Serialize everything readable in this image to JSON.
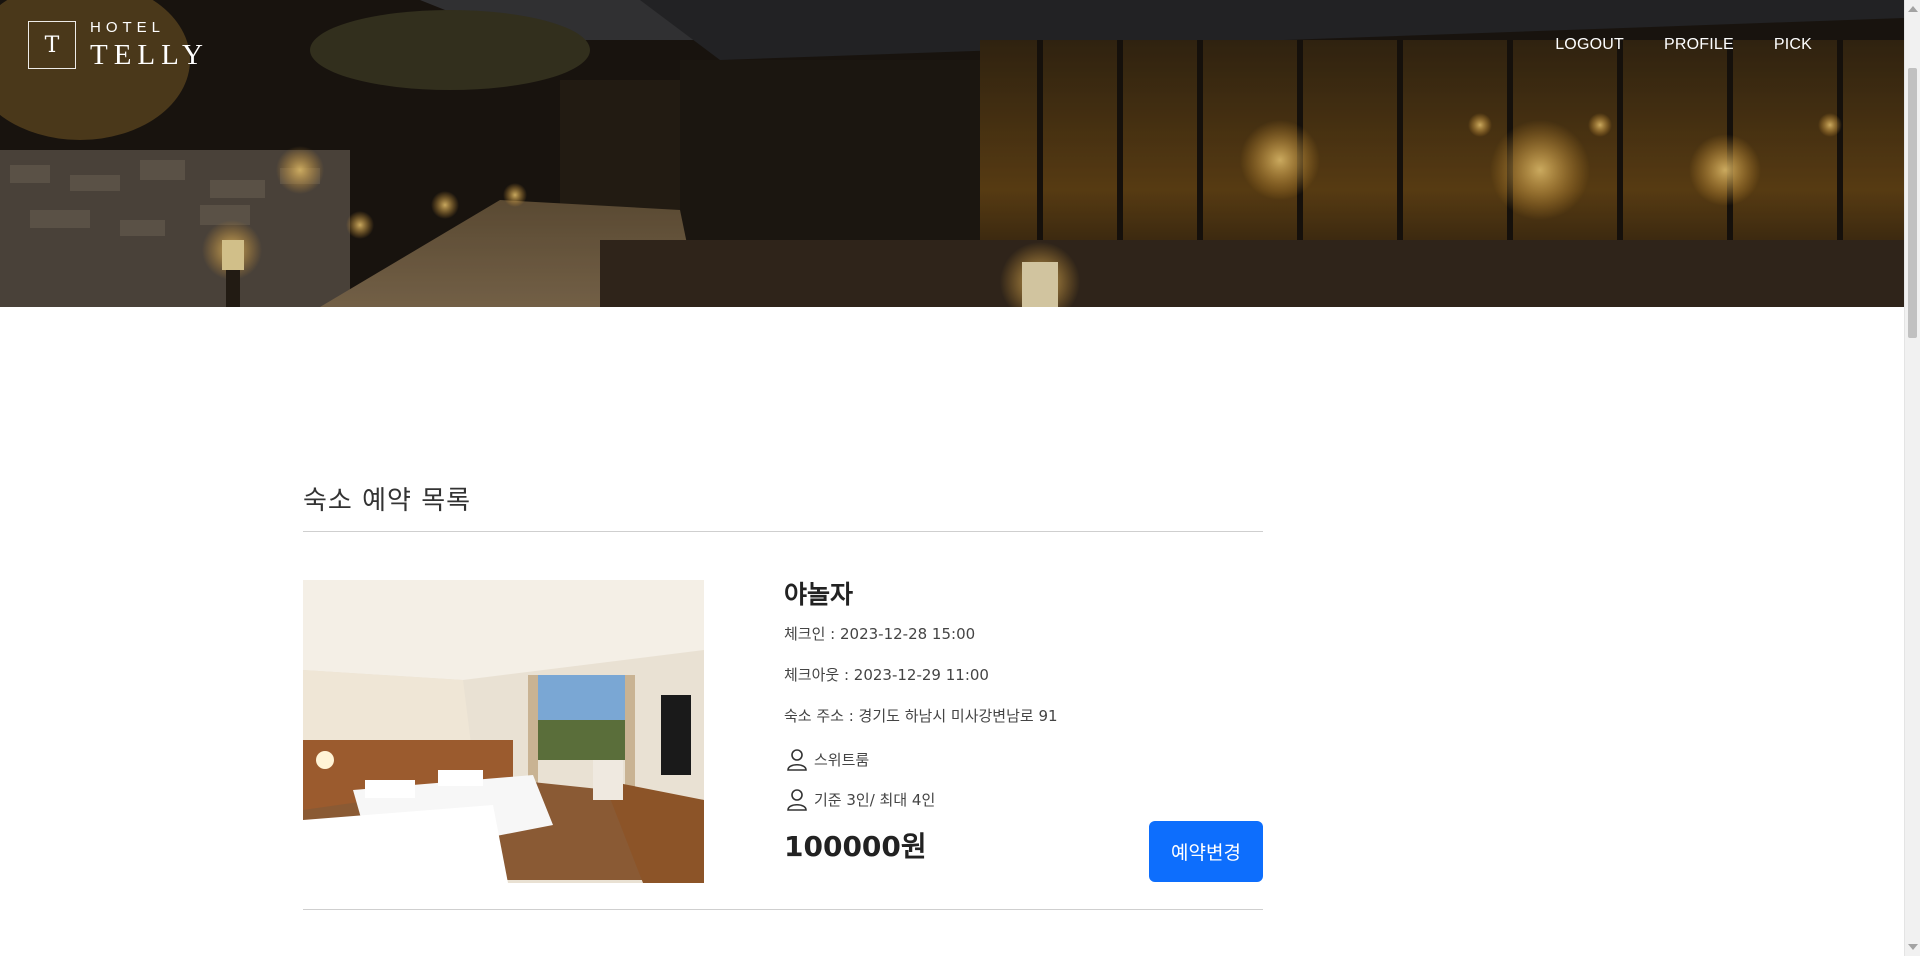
{
  "header": {
    "brand_letter": "T",
    "brand_small": "HOTEL",
    "brand_big": "TELLY",
    "nav": [
      {
        "label": "LOGOUT"
      },
      {
        "label": "PROFILE"
      },
      {
        "label": "PICK"
      }
    ]
  },
  "section": {
    "title": "숙소 예약 목록"
  },
  "reservation": {
    "hotel_name": "야놀자",
    "checkin": "체크인 : 2023-12-28 15:00",
    "checkout": "체크아웃 : 2023-12-29 11:00",
    "address": "숙소 주소 : 경기도 하남시 미사강변남로 91",
    "room_type": "스위트룸",
    "capacity": "기준 3인/ 최대 4인",
    "price": "100000원",
    "change_button": "예약변경"
  },
  "colors": {
    "accent": "#0d6efd",
    "divider": "#cfcfcf",
    "text": "#333333"
  },
  "icons": {
    "person": "person-outline-icon"
  }
}
